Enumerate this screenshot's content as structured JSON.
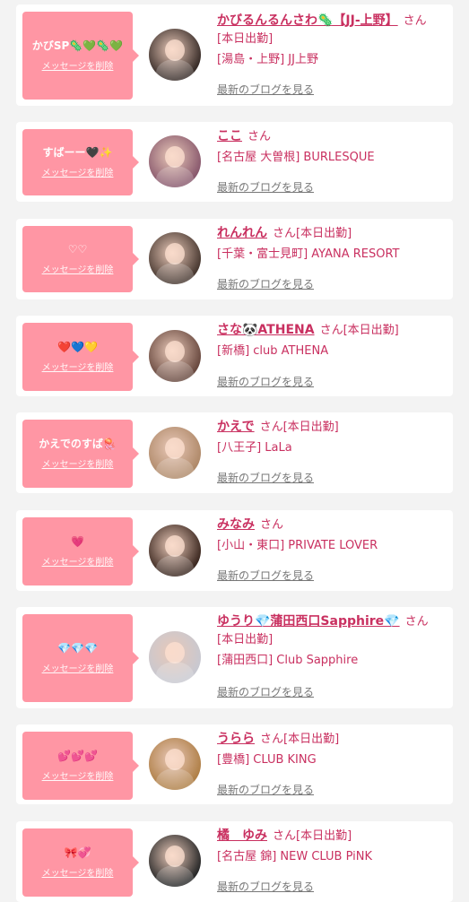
{
  "cards": [
    {
      "message": "かびSP🦠💚🦠💚",
      "delete_label": "メッセージを削除",
      "name": "かびるんるんさわ🦠【JJ-上野】",
      "suffix": "さん",
      "status": "[本日出勤]",
      "shop": "[湯島・上野] JJ上野",
      "blog_label": "最新のブログを見る",
      "avatar_color": "#3a2e2a"
    },
    {
      "message": "すばーー🖤✨",
      "delete_label": "メッセージを削除",
      "name": "ここ",
      "suffix": "さん",
      "status": "",
      "shop": "[名古屋 大曽根] BURLESQUE",
      "blog_label": "最新のブログを見る",
      "avatar_color": "#8a5a6e"
    },
    {
      "message": "♡♡",
      "delete_label": "メッセージを削除",
      "name": "れんれん",
      "suffix": "さん",
      "status": "[本日出勤]",
      "shop": "[千葉・富士見町] AYANA RESORT",
      "blog_label": "最新のブログを見る",
      "avatar_color": "#4a3a32"
    },
    {
      "message": "❤️💙💛",
      "delete_label": "メッセージを削除",
      "name": "さな🐼ATHENA",
      "suffix": "さん",
      "status": "[本日出勤]",
      "shop": "[新橋] club ATHENA",
      "blog_label": "最新のブログを見る",
      "avatar_color": "#6a4a40"
    },
    {
      "message": "かえでのすば🪼",
      "delete_label": "メッセージを削除",
      "name": "かえで",
      "suffix": "さん",
      "status": "[本日出勤]",
      "shop": "[八王子] LaLa",
      "blog_label": "最新のブログを見る",
      "avatar_color": "#b08a6a"
    },
    {
      "message": "💗",
      "delete_label": "メッセージを削除",
      "name": "みなみ",
      "suffix": "さん",
      "status": "",
      "shop": "[小山・東口] PRIVATE LOVER",
      "blog_label": "最新のブログを見る",
      "avatar_color": "#3e2a22"
    },
    {
      "message": "💎💎💎",
      "delete_label": "メッセージを削除",
      "name": "ゆうり💎蒲田西口Sapphire💎",
      "suffix": "さん",
      "status": "[本日出勤]",
      "shop": "[蒲田西口] Club Sapphire",
      "blog_label": "最新のブログを見る",
      "avatar_color": "#c8c8d0"
    },
    {
      "message": "💕💕💕",
      "delete_label": "メッセージを削除",
      "name": "うらら",
      "suffix": "さん",
      "status": "[本日出勤]",
      "shop": "[豊橋] CLUB KING",
      "blog_label": "最新のブログを見る",
      "avatar_color": "#b08048"
    },
    {
      "message": "🎀💞",
      "delete_label": "メッセージを削除",
      "name": "橘　ゆみ",
      "suffix": "さん",
      "status": "[本日出勤]",
      "shop": "[名古屋 錦] NEW CLUB PiNK",
      "blog_label": "最新のブログを見る",
      "avatar_color": "#2a2a2a"
    }
  ]
}
